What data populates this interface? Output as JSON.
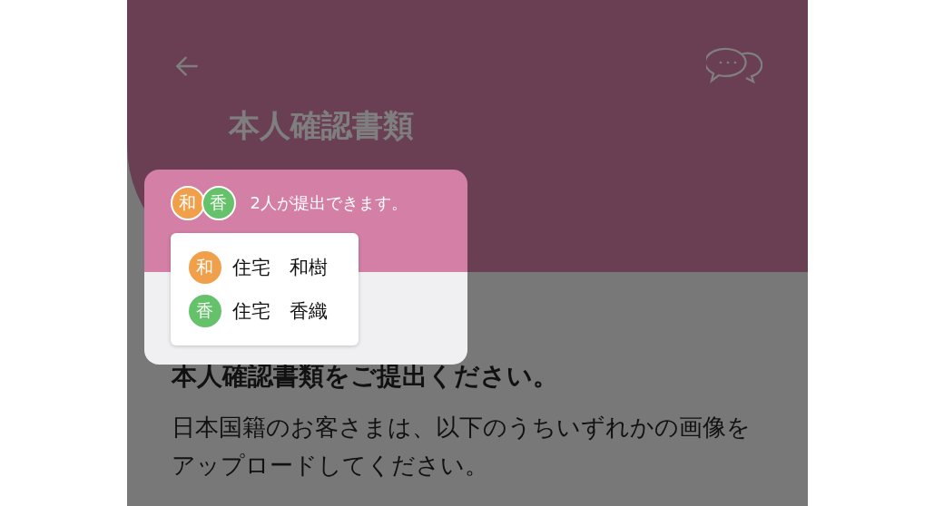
{
  "header": {
    "title": "本人確認書類"
  },
  "hint": {
    "avatars": [
      {
        "initial": "和",
        "color": "#f0a04b"
      },
      {
        "initial": "香",
        "color": "#66c26a"
      }
    ],
    "message": "2人が提出できます。",
    "members": [
      {
        "initial": "和",
        "name": "住宅　和樹",
        "color": "#f0a04b"
      },
      {
        "initial": "香",
        "name": "住宅　香織",
        "color": "#66c26a"
      }
    ]
  },
  "content": {
    "heading": "本人確認書類をご提出ください。",
    "body": "日本国籍のお客さまは、以下のうちいずれかの画像をアップロードしてください。"
  }
}
